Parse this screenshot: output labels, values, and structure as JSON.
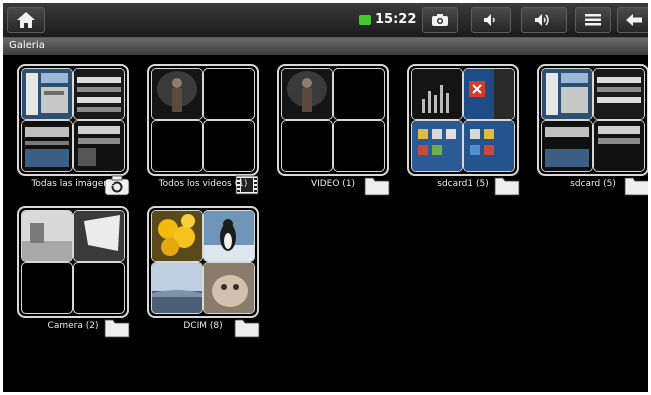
{
  "status_bar": {
    "time": "15:22",
    "battery_color": "#49c530",
    "buttons": [
      "home-icon",
      "camera-icon",
      "volume-down-icon",
      "volume-up-icon",
      "menu-icon",
      "back-icon"
    ]
  },
  "title_bar": {
    "title": "Galeria"
  },
  "albums": [
    {
      "label": "Todas las imágene",
      "badge": "camera-icon"
    },
    {
      "label": "Todos los videos (1)",
      "badge": "film-icon"
    },
    {
      "label": "VIDEO (1)",
      "badge": "folder-icon"
    },
    {
      "label": "sdcard1 (5)",
      "badge": "folder-icon"
    },
    {
      "label": "sdcard (5)",
      "badge": "folder-icon"
    },
    {
      "label": "Camera (2)",
      "badge": "folder-icon"
    },
    {
      "label": "DCIM (8)",
      "badge": "folder-icon"
    }
  ]
}
